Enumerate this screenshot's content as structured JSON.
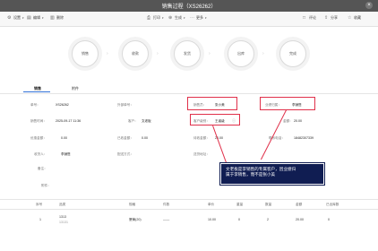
{
  "window": {
    "title": "销售过程（XS26262）",
    "close_glyph": "×"
  },
  "toolbar": {
    "left": [
      {
        "icon": "settings-icon",
        "label": "设置"
      },
      {
        "icon": "edit-icon",
        "label": "编辑"
      },
      {
        "icon": "delete-icon",
        "label": "删除"
      }
    ],
    "center": [
      {
        "icon": "print-icon",
        "label": "打印"
      },
      {
        "icon": "generate-icon",
        "label": "生成"
      },
      {
        "icon": "more-icon",
        "label": "更多"
      }
    ],
    "right": [
      {
        "icon": "comment-icon",
        "label": "评论"
      },
      {
        "icon": "share-icon",
        "label": "分享"
      },
      {
        "icon": "star-icon",
        "label": "收藏"
      }
    ]
  },
  "flow": [
    "销售",
    "收款",
    "发货",
    "出库",
    "完成"
  ],
  "tabs": [
    "销售",
    "附件"
  ],
  "form": {
    "row1": [
      {
        "label": "单号：",
        "value": "XS26262"
      },
      {
        "label": "外部单号：",
        "value": ""
      },
      {
        "label": "销售员：",
        "value": "张小美"
      },
      {
        "label": "业绩归属：",
        "value": "李销售"
      }
    ],
    "row2": [
      {
        "label": "销售时间：",
        "value": "2025-09-17 11:36"
      },
      {
        "label": "客户：",
        "value": "文老板"
      },
      {
        "label": "客户级别：",
        "value": "王者级"
      },
      {
        "label": "金额：",
        "value": "20.00"
      }
    ],
    "row3": [
      {
        "label": "优惠金额：",
        "value": "0.00"
      },
      {
        "label": "已收金额：",
        "value": "0.00"
      },
      {
        "label": "待收金额：",
        "value": "20.00"
      },
      {
        "label": "联系电话：",
        "value": "18482307339"
      }
    ],
    "row4": [
      {
        "label": "收货人：",
        "value": "李销售"
      },
      {
        "label": "配送方式：",
        "value": ""
      },
      {
        "label": "送货地址：",
        "value": ""
      }
    ],
    "row5": [
      {
        "label": "备注：",
        "value": ""
      }
    ],
    "row6": [
      {
        "label": "附件：",
        "value": ""
      }
    ]
  },
  "annotation": {
    "line1": "文老板是李销售的专属客户，因业绩归",
    "line2": "属于李销售，而不是张小美"
  },
  "table": {
    "headers": [
      "序号",
      "品类",
      "规格",
      "件数",
      "单价",
      "重量",
      "数量",
      "金额",
      "已出库数"
    ],
    "rows": [
      {
        "no": "1",
        "name": "1313",
        "sub": "13131",
        "spec": "蟹黄(20)",
        "pieces": "——",
        "price": "10.00",
        "weight": "0",
        "qty": "2",
        "amount": "20.00",
        "shipped": "0"
      }
    ]
  }
}
